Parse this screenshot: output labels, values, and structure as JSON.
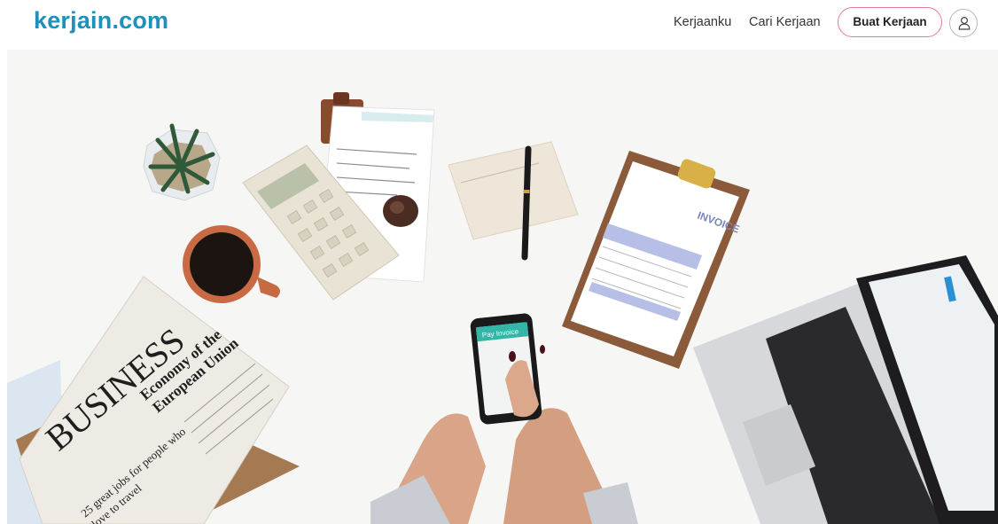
{
  "brand": {
    "logo_text": "kerjain.com",
    "color": "#1f8fbd"
  },
  "nav": {
    "links": [
      {
        "label": "Kerjaanku"
      },
      {
        "label": "Cari Kerjaan"
      }
    ],
    "cta_label": "Buat Kerjaan",
    "cta_border_color": "#e07a97",
    "user_icon": "user-icon"
  },
  "hero": {
    "newspaper": {
      "masthead": "BUSINESS",
      "headline_1": "Economy of the",
      "headline_2": "European Union",
      "subhead_1": "25 great jobs for people who",
      "subhead_2": "love to travel"
    },
    "phone": {
      "screen_title": "Pay Invoice"
    },
    "invoice": {
      "title": "INVOICE"
    }
  }
}
